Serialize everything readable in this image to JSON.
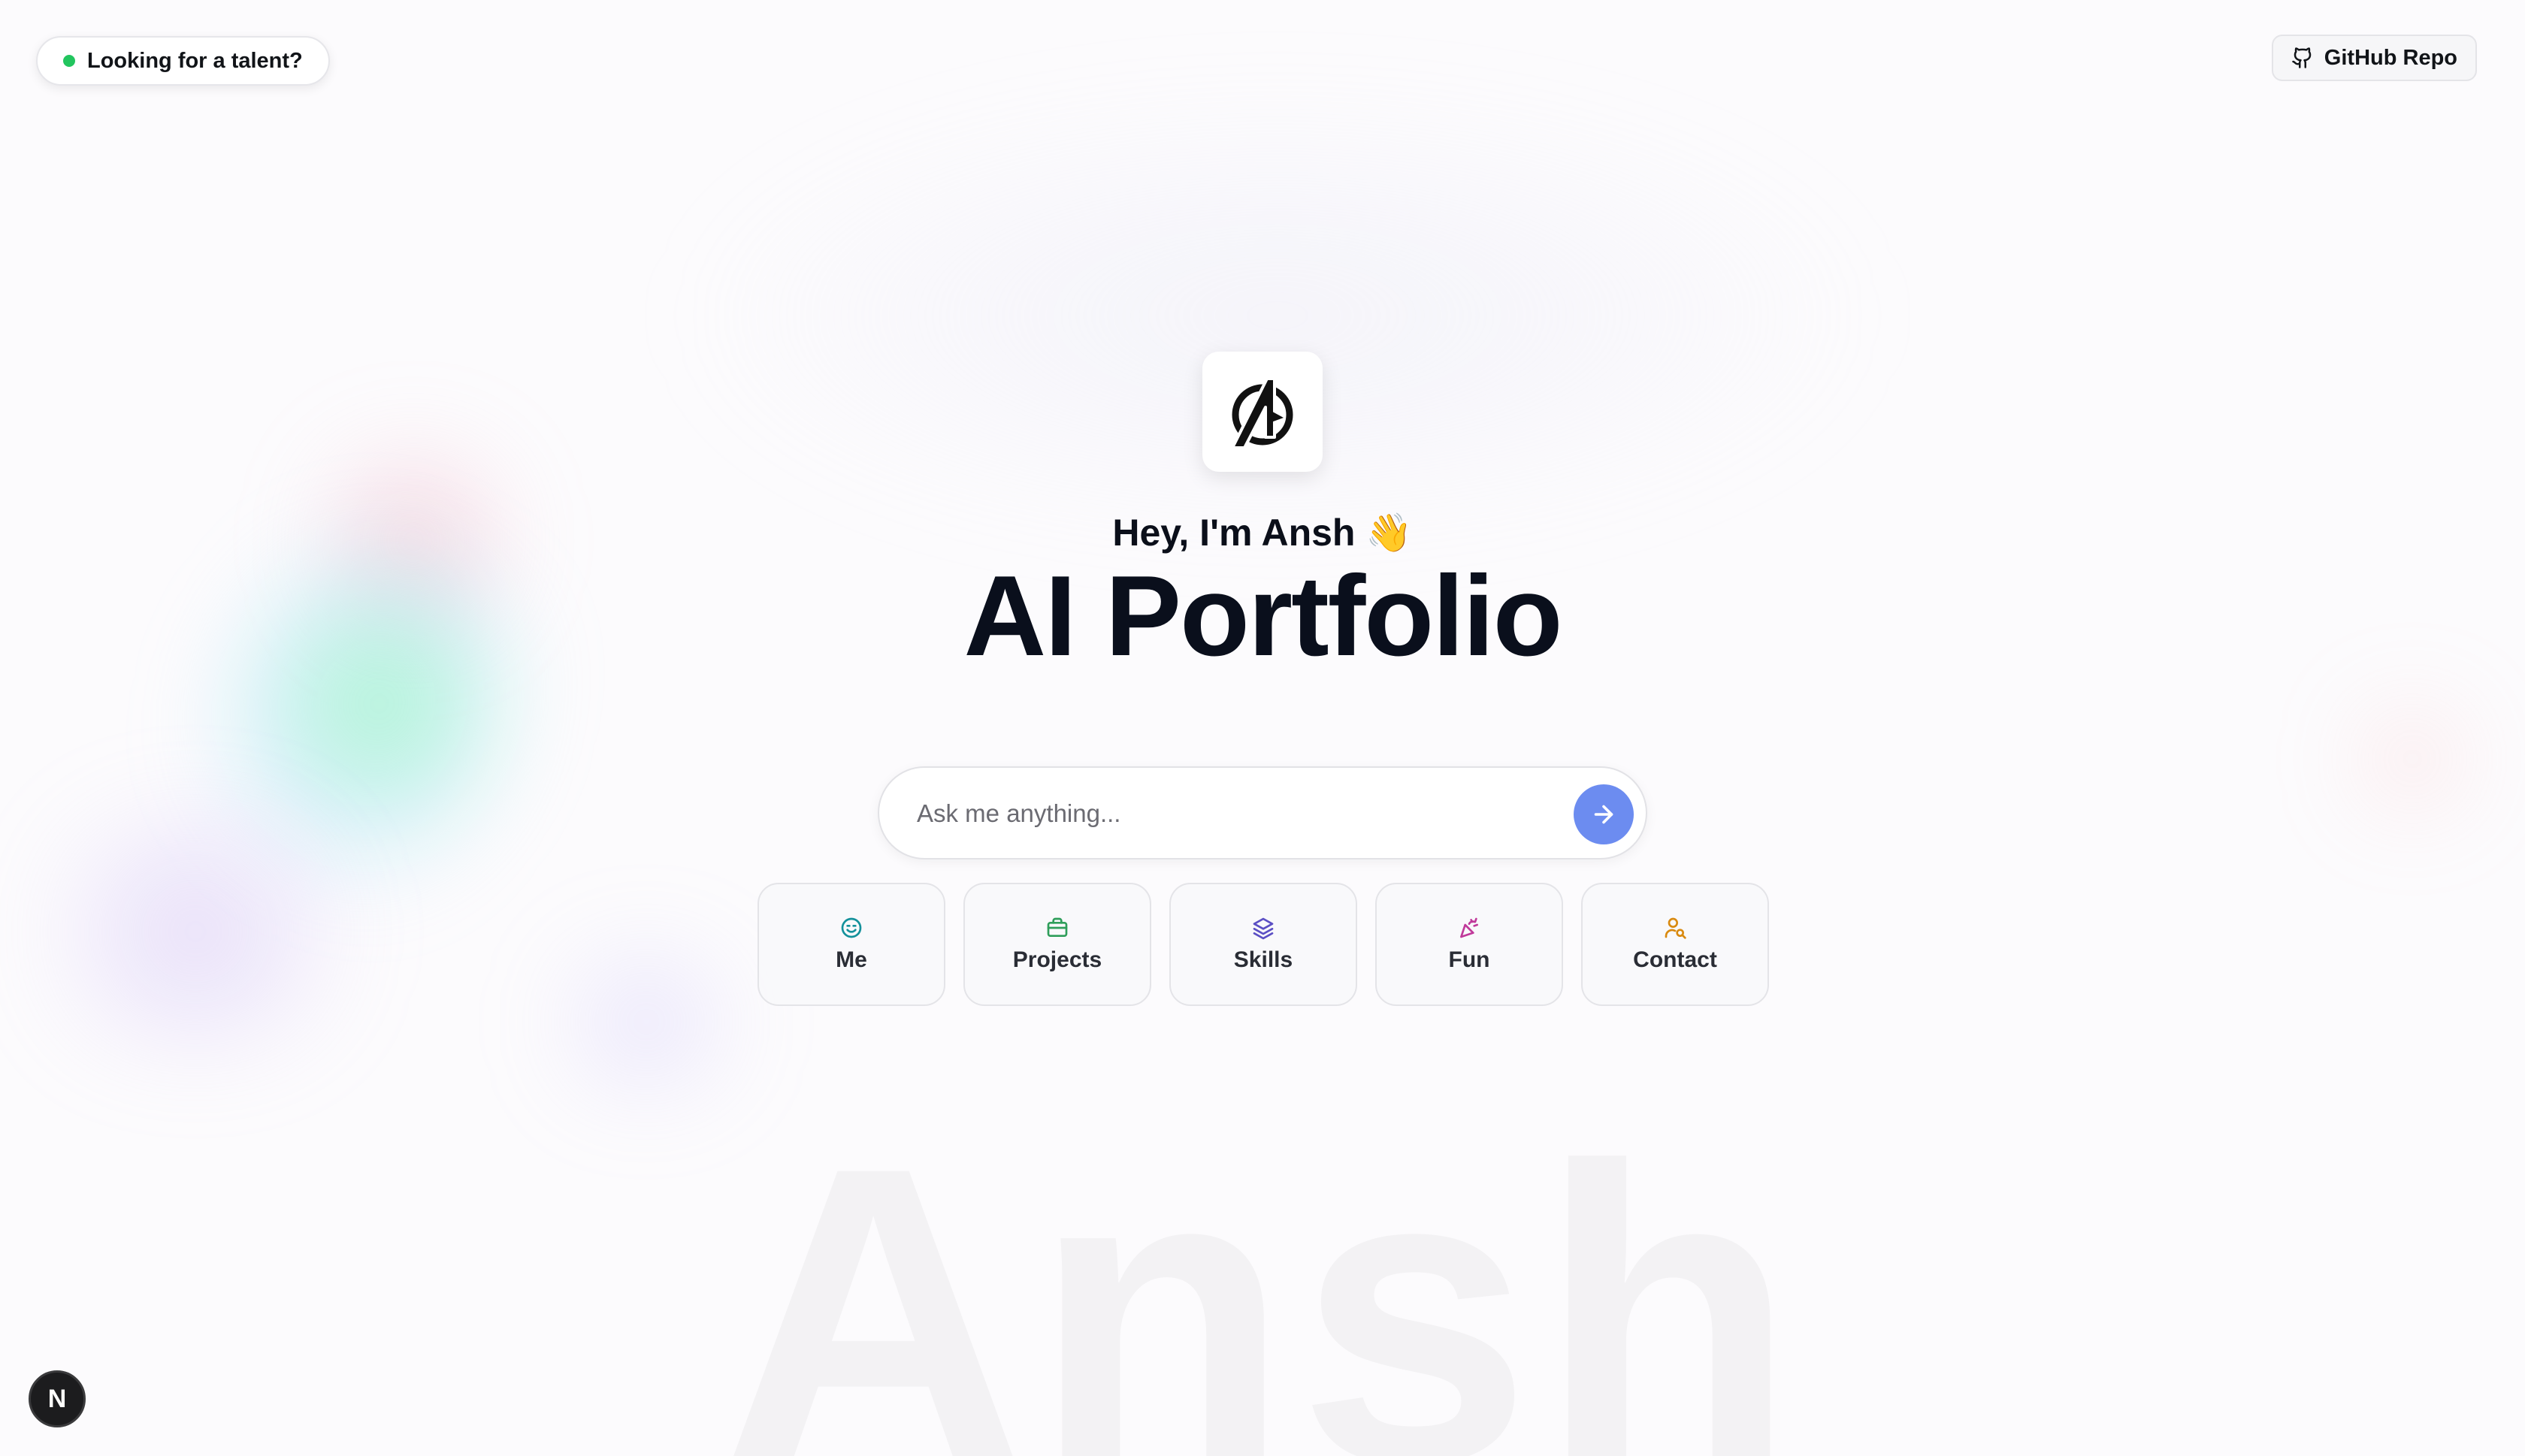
{
  "talent": {
    "label": "Looking for a talent?",
    "status_color": "#22c55e"
  },
  "header": {
    "github_label": "GitHub Repo",
    "github_icon": "github-icon"
  },
  "hero": {
    "logo_icon": "avengers-logo",
    "greeting": "Hey, I'm Ansh 👋",
    "title": "AI Portfolio"
  },
  "search": {
    "placeholder": "Ask me anything...",
    "value": "",
    "send_icon": "arrow-right-icon",
    "accent": "#6c8cf0"
  },
  "quick_actions": [
    {
      "label": "Me",
      "icon": "smile-icon",
      "color": "#14919b"
    },
    {
      "label": "Projects",
      "icon": "briefcase-icon",
      "color": "#2f9e5a"
    },
    {
      "label": "Skills",
      "icon": "layers-icon",
      "color": "#5b4fc4"
    },
    {
      "label": "Fun",
      "icon": "party-popper-icon",
      "color": "#c0399a"
    },
    {
      "label": "Contact",
      "icon": "user-search-icon",
      "color": "#d98a10"
    }
  ],
  "watermark": "Ansh",
  "dev_badge": {
    "letter": "N"
  }
}
